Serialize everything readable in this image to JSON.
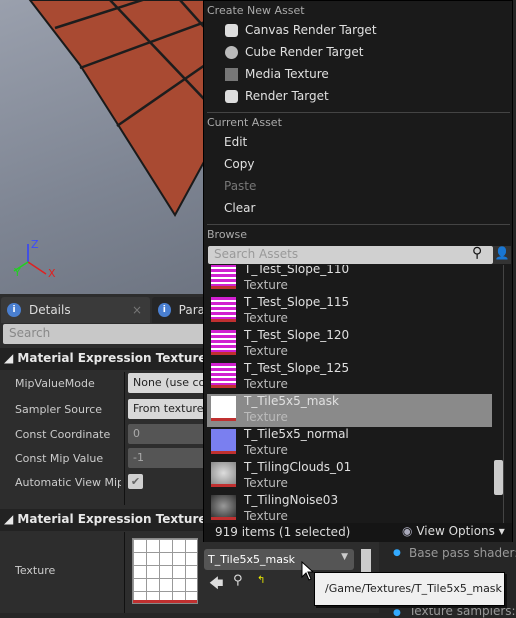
{
  "viewport": {
    "axis_labels": {
      "z": "Z",
      "x": "X",
      "y": "Y"
    }
  },
  "details": {
    "tabs": [
      {
        "label": "Details",
        "icon": "info-icon",
        "close": "×"
      },
      {
        "label": "Para",
        "icon": "info-icon"
      }
    ],
    "search_placeholder": "Search",
    "sections": [
      {
        "title": "Material Expression Texture Sam",
        "rows": [
          {
            "label": "MipValueMode",
            "value": "None (use con",
            "kind": "combo"
          },
          {
            "label": "Sampler Source",
            "value": "From texture a",
            "kind": "combo"
          },
          {
            "label": "Const Coordinate",
            "value": "0",
            "kind": "number"
          },
          {
            "label": "Const Mip Value",
            "value": "-1",
            "kind": "number"
          },
          {
            "label": "Automatic View Mip B",
            "value": true,
            "kind": "checkbox"
          }
        ]
      },
      {
        "title": "Material Expression Texture Base",
        "rows": [
          {
            "label": "Texture"
          }
        ]
      }
    ],
    "texture_combo": "T_Tile5x5_mask",
    "tooltip": "/Game/Textures/T_Tile5x5_mask",
    "right_notes": [
      "Base pass shader: ",
      "",
      "Texture samplers: "
    ]
  },
  "menu": {
    "create_header": "Create New Asset",
    "create_items": [
      {
        "label": "Canvas Render Target",
        "icon": "render-target-icon"
      },
      {
        "label": "Cube Render Target",
        "icon": "cube-icon"
      },
      {
        "label": "Media Texture",
        "icon": "media-texture-icon"
      },
      {
        "label": "Render Target",
        "icon": "render-target-icon"
      }
    ],
    "current_header": "Current Asset",
    "current_items": [
      {
        "label": "Edit",
        "enabled": true
      },
      {
        "label": "Copy",
        "enabled": true
      },
      {
        "label": "Paste",
        "enabled": false
      },
      {
        "label": "Clear",
        "enabled": true
      }
    ],
    "browse_header": "Browse",
    "search_placeholder": "Search Assets",
    "assets": [
      {
        "name": "T_Test_Slope_110",
        "type": "Texture",
        "thumb": "magenta"
      },
      {
        "name": "T_Test_Slope_115",
        "type": "Texture",
        "thumb": "magenta"
      },
      {
        "name": "T_Test_Slope_120",
        "type": "Texture",
        "thumb": "magenta"
      },
      {
        "name": "T_Test_Slope_125",
        "type": "Texture",
        "thumb": "magenta"
      },
      {
        "name": "T_Tile5x5_mask",
        "type": "Texture",
        "thumb": "grid",
        "selected": true
      },
      {
        "name": "T_Tile5x5_normal",
        "type": "Texture",
        "thumb": "normal"
      },
      {
        "name": "T_TilingClouds_01",
        "type": "Texture",
        "thumb": "clouds"
      },
      {
        "name": "T_TilingNoise03",
        "type": "Texture",
        "thumb": "noise"
      }
    ],
    "footer_count": "919 items (1 selected)",
    "view_options": "View Options"
  }
}
